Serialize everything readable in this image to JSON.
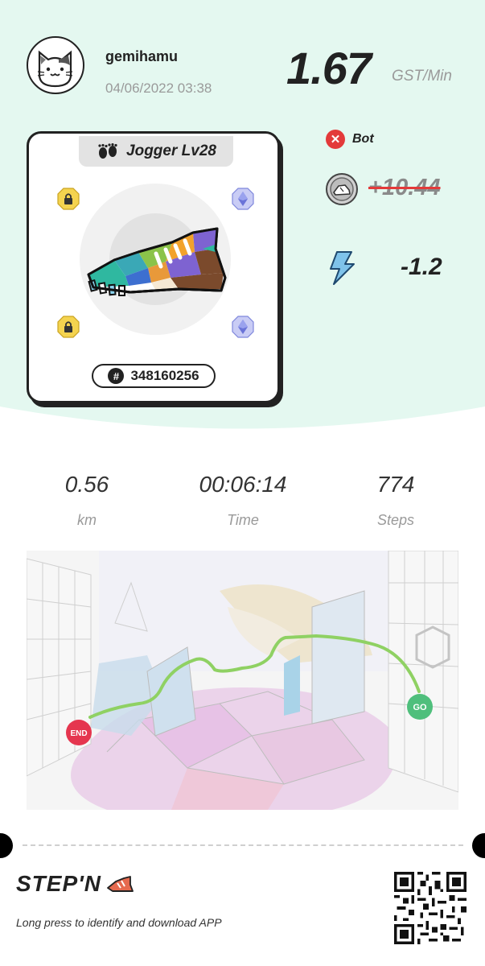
{
  "header": {
    "username": "gemihamu",
    "datetime": "04/06/2022 03:38",
    "gst_rate": "1.67",
    "gst_unit": "GST/Min"
  },
  "sneaker": {
    "type_label": "Jogger Lv28",
    "id": "348160256",
    "slots": [
      {
        "position": "top-left",
        "state": "locked",
        "icon": "lock-icon"
      },
      {
        "position": "top-right",
        "state": "gem",
        "icon": "gem-icon"
      },
      {
        "position": "bottom-left",
        "state": "locked",
        "icon": "lock-icon"
      },
      {
        "position": "bottom-right",
        "state": "gem",
        "icon": "gem-icon"
      }
    ]
  },
  "result": {
    "bot_label": "Bot",
    "earnings": "+10.44",
    "energy": "-1.2"
  },
  "stats": [
    {
      "value": "0.56",
      "label": "km"
    },
    {
      "value": "00:06:14",
      "label": "Time"
    },
    {
      "value": "774",
      "label": "Steps"
    }
  ],
  "map": {
    "start_label": "GO",
    "end_label": "END"
  },
  "footer": {
    "brand": "STEP'N",
    "tagline": "Long press to identify and download APP"
  },
  "colors": {
    "mint_bg": "#e4f8f0",
    "route": "#8fd163",
    "go": "#4fbf7c",
    "end": "#e5364f",
    "strike": "#e33a3a"
  }
}
